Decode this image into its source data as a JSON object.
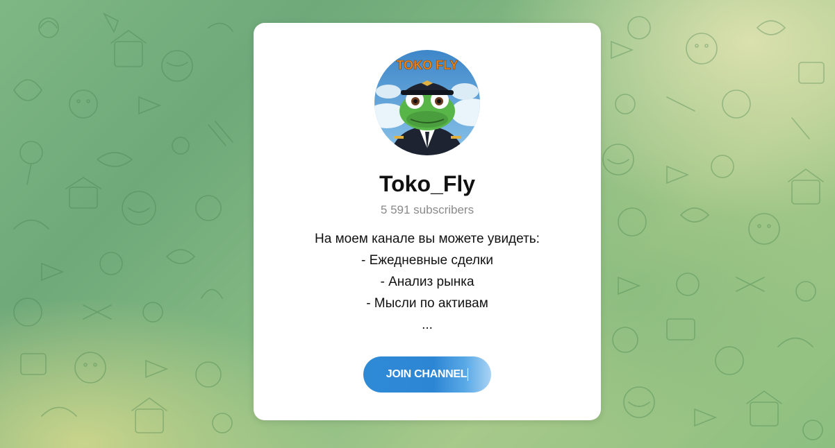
{
  "channel": {
    "name": "Toko_Fly",
    "subscribers": "5 591 subscribers",
    "avatar_text": "TOKO FLY",
    "description": [
      "На моем канале вы можете увидеть:",
      "- Ежедневные сделки",
      "- Анализ рынка",
      "- Мысли по активам",
      "..."
    ]
  },
  "join_button": {
    "label": "JOIN CHANNEL"
  },
  "colors": {
    "accent": "#2f8ad6",
    "background_green": "#7fb784",
    "card": "#ffffff"
  },
  "icons": [
    "frog-pilot-avatar",
    "doodle-pattern-background"
  ]
}
